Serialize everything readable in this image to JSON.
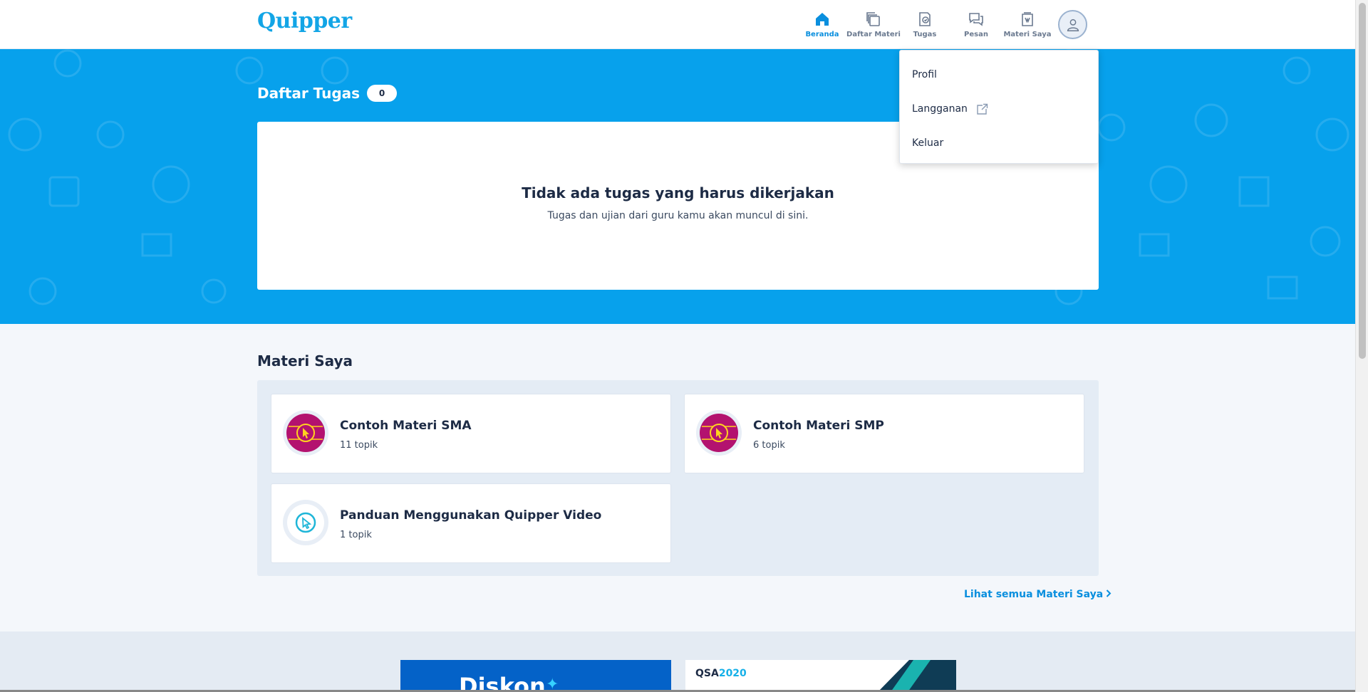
{
  "header": {
    "logo": "Quipper",
    "nav": [
      {
        "label": "Beranda",
        "icon": "home-icon",
        "active": true
      },
      {
        "label": "Daftar Materi",
        "icon": "course-list-icon",
        "active": false
      },
      {
        "label": "Tugas",
        "icon": "assignment-icon",
        "active": false
      },
      {
        "label": "Pesan",
        "icon": "message-icon",
        "active": false
      },
      {
        "label": "Materi Saya",
        "icon": "my-course-icon",
        "active": false
      }
    ],
    "avatar_icon": "user-icon"
  },
  "dropdown": {
    "items": [
      {
        "label": "Profil"
      },
      {
        "label": "Langganan",
        "icon": "external-link-icon"
      },
      {
        "label": "Keluar"
      }
    ]
  },
  "assignments": {
    "title": "Daftar Tugas",
    "count": "0",
    "empty_title": "Tidak ada tugas yang harus dikerjakan",
    "empty_text": "Tugas dan ujian dari guru kamu akan muncul di sini."
  },
  "my_courses": {
    "title": "Materi Saya",
    "courses": [
      {
        "name": "Contoh Materi SMA",
        "topics": "11 topik",
        "icon": "cursor-badge-icon"
      },
      {
        "name": "Contoh Materi SMP",
        "topics": "6 topik",
        "icon": "cursor-badge-icon"
      },
      {
        "name": "Panduan Menggunakan Quipper Video",
        "topics": "1 topik",
        "icon": "cursor-outline-icon"
      }
    ],
    "see_all": "Lihat semua Materi Saya"
  },
  "banners": {
    "left_text": "Diskon",
    "right_prefix": "QSA",
    "right_year": "2020"
  },
  "colors": {
    "brand": "#12a5e6",
    "hero": "#07a1ec",
    "link": "#0a8fde",
    "course_badge": "#b3126f"
  }
}
